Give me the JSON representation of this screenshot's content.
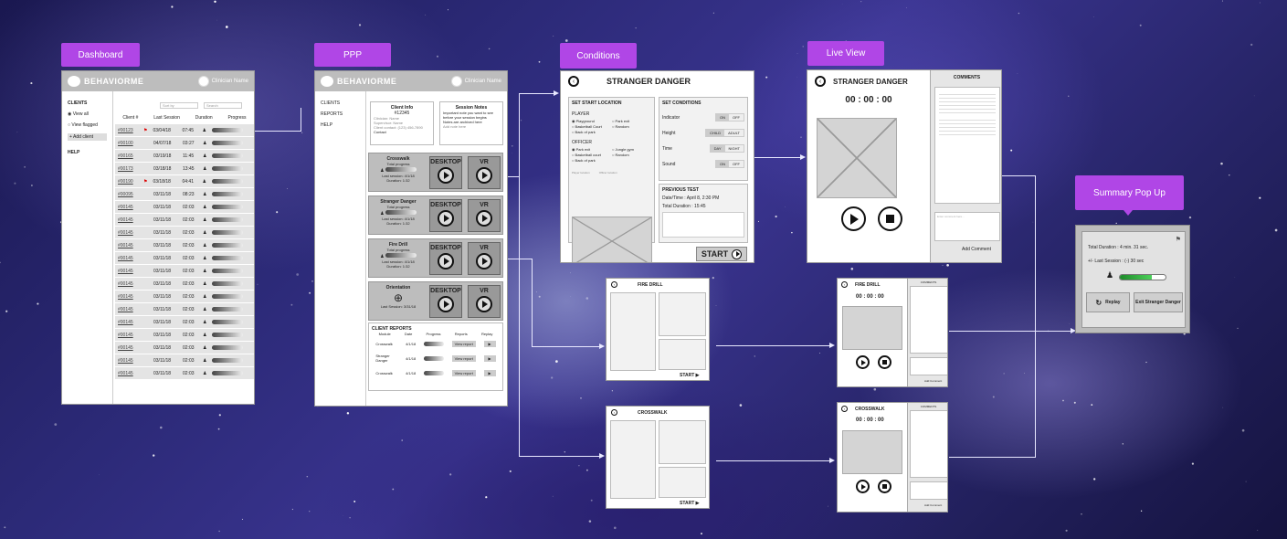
{
  "tags": {
    "dashboard": "Dashboard",
    "ppp": "PPP",
    "conditions": "Conditions",
    "live_view": "Live View",
    "summary": "Summary Pop Up"
  },
  "brand": "BEHAVIORME",
  "clinician": "Clinician Name",
  "dashboard": {
    "sidebar": [
      "CLIENTS",
      "View all",
      "View flagged",
      "+ Add client",
      "HELP"
    ],
    "filters": [
      "Sort by",
      "Search"
    ],
    "headers": [
      "Client #",
      "Last Session",
      "Duration",
      "Progress"
    ],
    "rows": [
      [
        "#00123",
        "03/04/18",
        "07:45"
      ],
      [
        "#00100",
        "04/07/18",
        "03:27"
      ],
      [
        "#00165",
        "03/19/18",
        "11:45"
      ],
      [
        "#00173",
        "03/18/18",
        "13:45"
      ],
      [
        "#00190",
        "03/18/18",
        "04:41"
      ],
      [
        "#00095",
        "03/11/18",
        "08:23"
      ],
      [
        "#00145",
        "03/11/18",
        "02:03"
      ],
      [
        "#00145",
        "03/11/18",
        "02:03"
      ],
      [
        "#00145",
        "03/11/18",
        "02:03"
      ],
      [
        "#00145",
        "03/11/18",
        "02:03"
      ],
      [
        "#00145",
        "03/11/18",
        "02:03"
      ],
      [
        "#00145",
        "03/11/18",
        "02:03"
      ],
      [
        "#00145",
        "03/11/18",
        "02:03"
      ],
      [
        "#00145",
        "03/11/18",
        "02:03"
      ],
      [
        "#00145",
        "03/11/18",
        "02:03"
      ],
      [
        "#00145",
        "03/11/18",
        "02:03"
      ],
      [
        "#00145",
        "03/11/18",
        "02:03"
      ],
      [
        "#00145",
        "03/11/18",
        "02:03"
      ],
      [
        "#00145",
        "03/11/18",
        "02:03"
      ],
      [
        "#00145",
        "03/11/18",
        "02:03"
      ]
    ]
  },
  "ppp": {
    "sidebar": [
      "CLIENTS",
      "REPORTS",
      "HELP"
    ],
    "client_info_title": "Client Info",
    "client_id": "#12345",
    "client_lines": [
      "Clinician: Name",
      "Supervisor: Name",
      "Client contact: (123) 456-7890",
      "Contact"
    ],
    "notes_title": "Session Notes",
    "notes": [
      "Important note you want to see before your session begins",
      "Notes are archived here",
      "Add note here"
    ],
    "modules": [
      {
        "name": "Crosswalk",
        "sub": "Total progress",
        "last": "Last session: 4/1/18",
        "dur": "Duration: 1:32"
      },
      {
        "name": "Stranger Danger",
        "sub": "Total progress",
        "last": "Last session: 4/1/18",
        "dur": "Duration: 1:32"
      },
      {
        "name": "Fire Drill",
        "sub": "Total progress",
        "last": "Last session: 4/1/18",
        "dur": "Duration: 1:32"
      },
      {
        "name": "Orientation",
        "sub": "",
        "last": "Last Session: 3/31/18",
        "dur": ""
      }
    ],
    "desktop": "DESKTOP",
    "vr": "VR",
    "reports_title": "CLIENT REPORTS",
    "report_headers": [
      "Module",
      "Date",
      "Progress",
      "Reports",
      "Replay"
    ],
    "report_rows": [
      [
        "Crosswalk",
        "4/1/18",
        "View report"
      ],
      [
        "Stranger Danger",
        "4/1/18",
        "View report"
      ],
      [
        "Crosswalk",
        "4/1/18",
        "View report"
      ]
    ]
  },
  "conditions": {
    "title": "STRANGER DANGER",
    "set_start": "SET START LOCATION",
    "player": "PLAYER",
    "player_opts": [
      "Playground",
      "Park exit",
      "Basketball Court",
      "Random",
      "Back of park"
    ],
    "officer": "OFFICER",
    "officer_opts": [
      "Park exit",
      "Jungle gym",
      "Basketball court",
      "Random",
      "Back of park"
    ],
    "map_legend": [
      "Player location",
      "Officer location"
    ],
    "set_conditions": "SET CONDITIONS",
    "conds": [
      {
        "label": "Indicator",
        "a": "ON",
        "b": "OFF"
      },
      {
        "label": "Height",
        "a": "CHILD",
        "b": "ADULT"
      },
      {
        "label": "Time",
        "a": "DAY",
        "b": "NIGHT"
      },
      {
        "label": "Sound",
        "a": "ON",
        "b": "OFF"
      }
    ],
    "previous": "PREVIOUS TEST",
    "date": "Date/Time : April 8, 2:30 PM",
    "duration": "Total Duration : 15:45",
    "start": "START"
  },
  "live": {
    "title": "STRANGER DANGER",
    "timer": "00 : 00 : 00",
    "comments": "COMMENTS",
    "add": "Add Comment",
    "placeholder": "Enter comment here..."
  },
  "small": {
    "fire": "FIRE DRILL",
    "cross": "CROSSWALK",
    "start": "START",
    "timer": "00 : 00 : 00",
    "comments": "COMMENTS",
    "add": "Add Comment"
  },
  "summary": {
    "duration": "Total Duration : 4 min. 31 sec.",
    "last": "+/- Last Session : (-) 30 sec",
    "replay": "Replay",
    "exit": "Exit Stranger Danger",
    "progress": 0.7
  }
}
